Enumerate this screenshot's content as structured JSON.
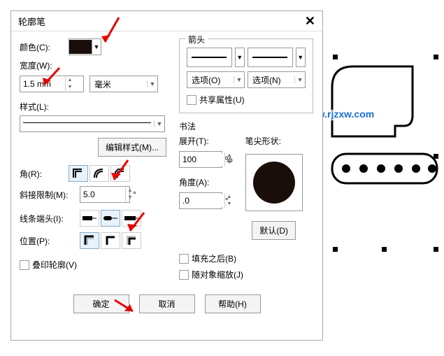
{
  "dialog": {
    "title": "轮廓笔"
  },
  "color": {
    "label": "颜色(C):"
  },
  "width": {
    "label": "宽度(W):",
    "value": "1.5 mm",
    "unit": "毫米"
  },
  "style": {
    "label": "样式(L):",
    "editBtn": "编辑样式(M)..."
  },
  "corner": {
    "label": "角(R):"
  },
  "miter": {
    "label": "斜接限制(M):",
    "value": "5.0",
    "unit": "°"
  },
  "cap": {
    "label": "线条端头(I):"
  },
  "position": {
    "label": "位置(P):"
  },
  "overprint": {
    "label": "叠印轮廓(V)"
  },
  "arrowhead": {
    "title": "箭头",
    "opt_left": "选项(O)",
    "opt_right": "选项(N)",
    "share": "共享属性(U)"
  },
  "calligraphy": {
    "title": "书法",
    "spread_label": "展开(T):",
    "spread_value": "100",
    "spread_unit": "%",
    "angle_label": "角度(A):",
    "angle_value": ".0",
    "angle_unit": "°",
    "nib_label": "笔尖形状:",
    "default_btn": "默认(D)"
  },
  "behindFill": {
    "label": "填充之后(B)"
  },
  "scaleWithObject": {
    "label": "随对象缩放(J)"
  },
  "buttons": {
    "ok": "确定",
    "cancel": "取消",
    "help": "帮助(H)"
  },
  "watermark": "www.rjzxw.com"
}
